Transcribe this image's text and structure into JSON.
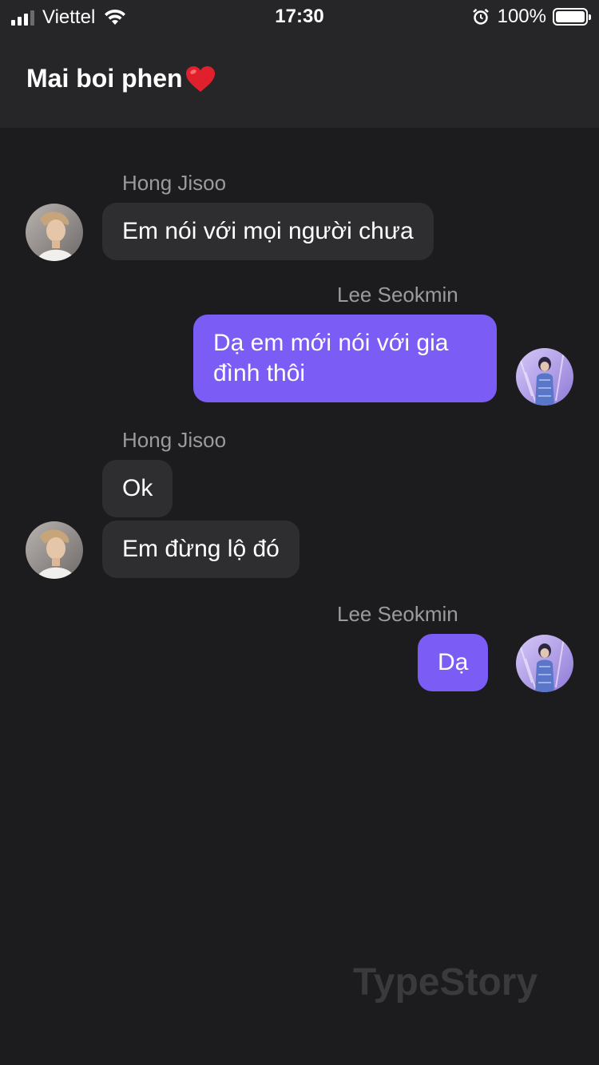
{
  "status_bar": {
    "carrier": "Viettel",
    "time": "17:30",
    "battery": "100%"
  },
  "header": {
    "title": "Mai boi phen"
  },
  "messages": [
    {
      "sender": "Hong Jisoo",
      "side": "incoming",
      "texts": [
        "Em nói với mọi người chưa"
      ]
    },
    {
      "sender": "Lee Seokmin",
      "side": "outgoing",
      "texts": [
        "Dạ em mới nói với gia đình thôi"
      ]
    },
    {
      "sender": "Hong Jisoo",
      "side": "incoming",
      "texts": [
        "Ok",
        "Em đừng lộ đó"
      ]
    },
    {
      "sender": "Lee Seokmin",
      "side": "outgoing",
      "texts": [
        "Dạ"
      ]
    }
  ],
  "watermark": "TypeStory",
  "colors": {
    "background": "#1c1c1e",
    "header": "#262628",
    "incoming_bubble": "#2e2e31",
    "outgoing_bubble": "#7b5cf5",
    "sender_name": "#9a9a9f"
  },
  "icons": [
    "signal-icon",
    "wifi-icon",
    "alarm-icon",
    "battery-icon",
    "heart-emoji"
  ]
}
